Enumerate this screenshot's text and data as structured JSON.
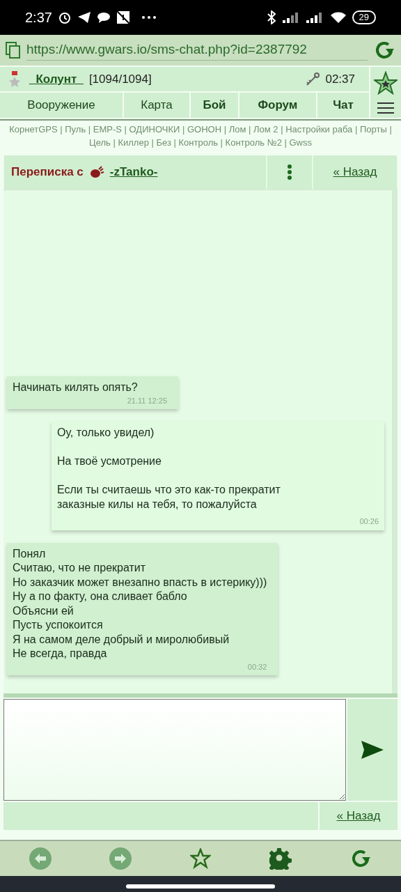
{
  "status_bar": {
    "time": "2:37",
    "battery": "29"
  },
  "browser": {
    "url": "https://www.gwars.io/sms-chat.php?id=2387792"
  },
  "player": {
    "name": "_Колунт_",
    "hp": "[1094/1094]",
    "time": "02:37"
  },
  "nav": [
    {
      "label": "Вооружение",
      "bold": false
    },
    {
      "label": "Карта",
      "bold": false
    },
    {
      "label": "Бой",
      "bold": true
    },
    {
      "label": "Форум",
      "bold": true
    },
    {
      "label": "Чат",
      "bold": true
    }
  ],
  "quick_links": {
    "separator": "|",
    "items": [
      "КорнетGPS",
      "Пуль",
      "EMP-S",
      "ОДИНОЧКИ",
      "GOНОН",
      "Лом",
      "Лом 2",
      "Настройки раба",
      "Порты",
      "Цель",
      "Киллер",
      "Без",
      "Контроль",
      "Контроль №2",
      "Gwss"
    ]
  },
  "chat_header": {
    "title": "Переписка с",
    "contact": "-zTanko-",
    "back": "« Назад"
  },
  "messages": [
    {
      "kind": "incoming",
      "text": "Начинать килять опять?",
      "time": "21.11 12:25"
    },
    {
      "kind": "outgoing",
      "text": "Оу, только увидел)\n\nНа твоё усмотрение\n\nЕсли ты считаешь что это как-то прекратит\nзаказные килы на тебя, то пожалуйста",
      "time": "00:26"
    },
    {
      "kind": "incoming",
      "text": "Понял\nСчитаю, что не прекратит\nНо заказчик может внезапно впасть в истерику)))\nНу а по факту, она сливает бабло\nОбъясни ей\nПусть успокоится\nЯ на самом деле добрый и миролюбивый\nНе всегда, правда",
      "time": "00:32"
    }
  ],
  "footer": {
    "back": "« Назад"
  }
}
